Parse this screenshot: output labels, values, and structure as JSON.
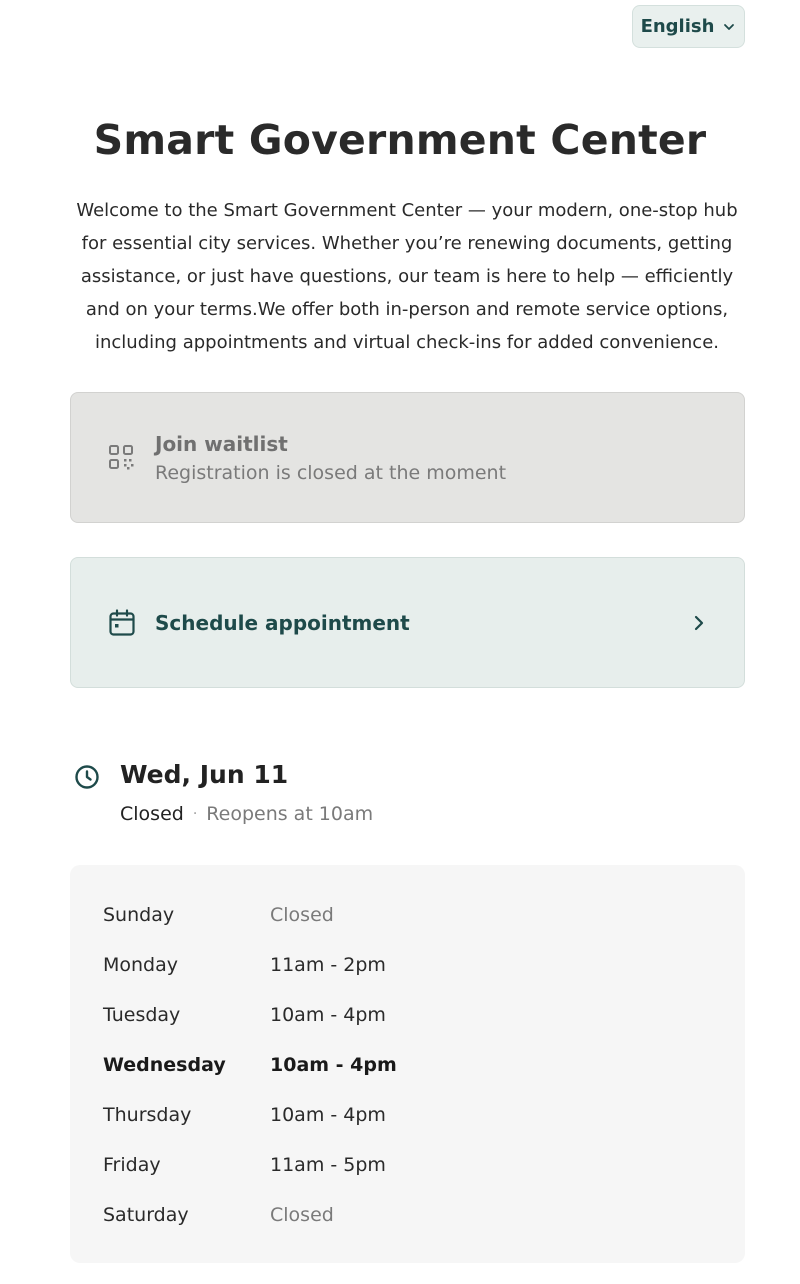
{
  "language": {
    "label": "English",
    "icon": "chevron-down-icon"
  },
  "title": "Smart Government Center",
  "intro": "Welcome to the Smart Government Center — your modern, one-stop hub for essential city services. Whether you’re renewing documents, getting assistance, or just have questions, our team is here to help — efficiently and on your terms.We offer both in-person and remote service options, including appointments and virtual check-ins for added convenience.",
  "waitlist": {
    "icon": "qr-code-icon",
    "title": "Join waitlist",
    "subtitle": "Registration is closed at the moment",
    "disabled": true
  },
  "schedule": {
    "icon": "calendar-icon",
    "title": "Schedule appointment",
    "action_icon": "chevron-right-icon"
  },
  "status": {
    "icon": "clock-icon",
    "date": "Wed, Jun 11",
    "state": "Closed",
    "separator": "·",
    "reopens": "Reopens at 10am"
  },
  "hours": [
    {
      "day": "Sunday",
      "time": "Closed",
      "closed": true,
      "today": false
    },
    {
      "day": "Monday",
      "time": "11am - 2pm",
      "closed": false,
      "today": false
    },
    {
      "day": "Tuesday",
      "time": "10am - 4pm",
      "closed": false,
      "today": false
    },
    {
      "day": "Wednesday",
      "time": "10am - 4pm",
      "closed": false,
      "today": true
    },
    {
      "day": "Thursday",
      "time": "10am - 4pm",
      "closed": false,
      "today": false
    },
    {
      "day": "Friday",
      "time": "11am - 5pm",
      "closed": false,
      "today": false
    },
    {
      "day": "Saturday",
      "time": "Closed",
      "closed": true,
      "today": false
    }
  ],
  "colors": {
    "accent": "#1e4a4a",
    "card_accent_bg": "#e7eeec",
    "card_disabled_bg": "#e4e4e2",
    "hours_bg": "#f6f6f6",
    "muted_text": "#7a7a7a"
  }
}
